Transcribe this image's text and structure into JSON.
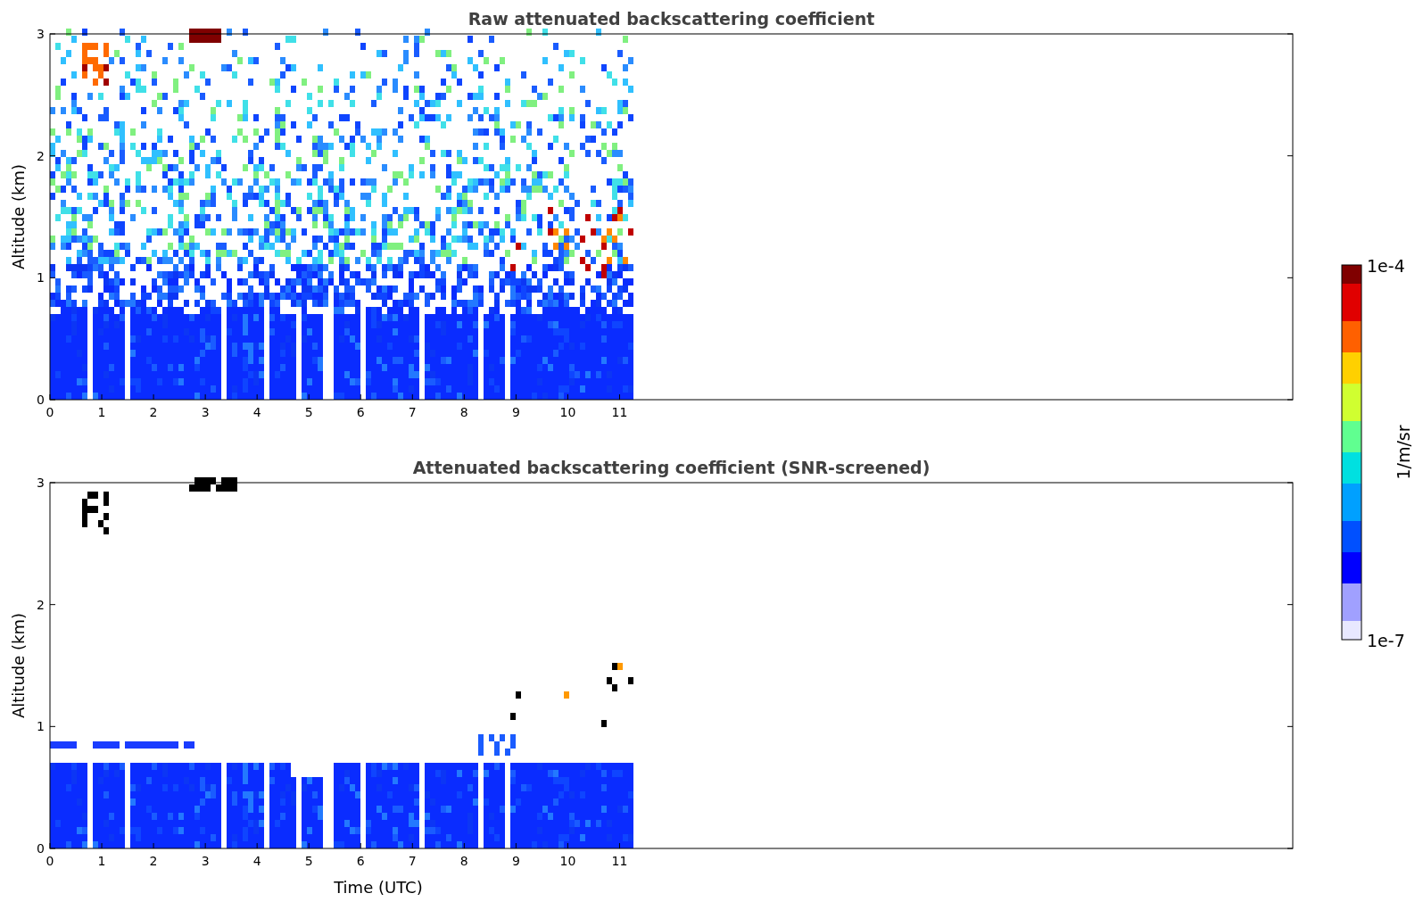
{
  "panels": [
    {
      "kind": "raw",
      "title": "Raw attenuated backscattering coefficient",
      "ylabel": "Altitude (km)",
      "yticks": [
        "3",
        "2",
        "1",
        "0"
      ],
      "xticks": [
        "0",
        "1",
        "2",
        "3",
        "4",
        "5",
        "6",
        "7",
        "8",
        "9",
        "10",
        "11"
      ]
    },
    {
      "kind": "screened",
      "title": "Attenuated backscattering coefficient (SNR-screened)",
      "ylabel": "Altitude (km)",
      "yticks": [
        "3",
        "2",
        "1",
        "0"
      ],
      "xticks": [
        "0",
        "1",
        "2",
        "3",
        "4",
        "5",
        "6",
        "7",
        "8",
        "9",
        "10",
        "11"
      ],
      "xlabel": "Time (UTC)"
    }
  ],
  "colorbar": {
    "max_label": "1e-4",
    "min_label": "1e-7",
    "label": "1/m/sr"
  }
}
